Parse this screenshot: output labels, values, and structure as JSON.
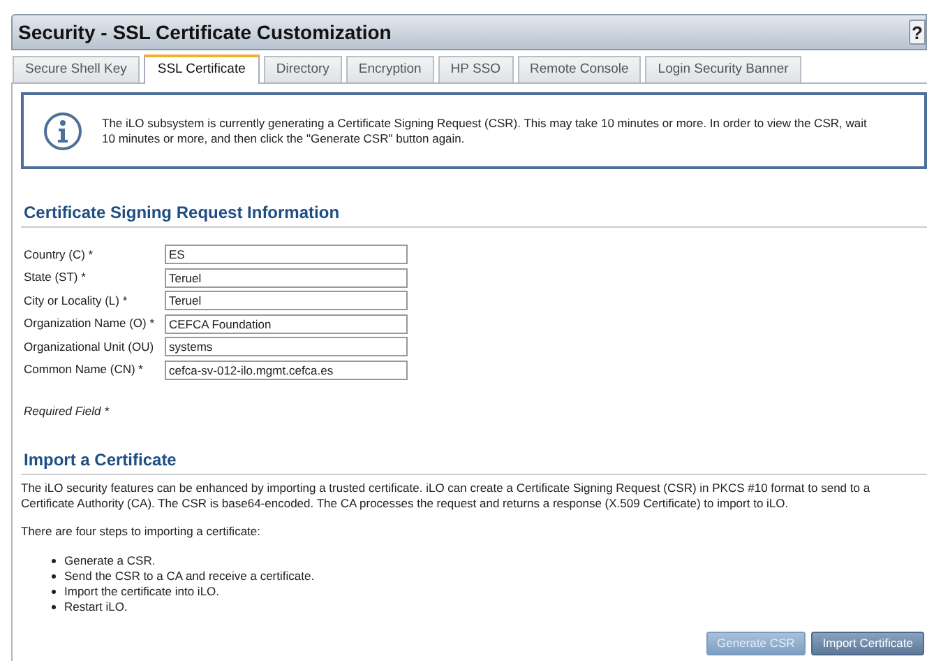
{
  "window": {
    "title": "Security - SSL Certificate Customization",
    "help": "?"
  },
  "tabs": [
    {
      "label": "Secure Shell Key",
      "selected": false
    },
    {
      "label": "SSL Certificate",
      "selected": true
    },
    {
      "label": "Directory",
      "selected": false
    },
    {
      "label": "Encryption",
      "selected": false
    },
    {
      "label": "HP SSO",
      "selected": false
    },
    {
      "label": "Remote Console",
      "selected": false
    },
    {
      "label": "Login Security Banner",
      "selected": false
    }
  ],
  "notice": "The iLO subsystem is currently generating a Certificate Signing Request (CSR). This may take 10 minutes or more. In order to view the CSR, wait 10 minutes or more, and then click the \"Generate CSR\" button again.",
  "csr_section": {
    "heading": "Certificate Signing Request Information",
    "fields": [
      {
        "label": "Country (C) *",
        "value": "ES"
      },
      {
        "label": "State (ST) *",
        "value": "Teruel"
      },
      {
        "label": "City or Locality (L) *",
        "value": "Teruel"
      },
      {
        "label": "Organization Name (O) *",
        "value": "CEFCA Foundation"
      },
      {
        "label": "Organizational Unit (OU)",
        "value": "systems"
      },
      {
        "label": "Common Name (CN) *",
        "value": "cefca-sv-012-ilo.mgmt.cefca.es"
      }
    ],
    "required_note": "Required Field *"
  },
  "import_section": {
    "heading": "Import a Certificate",
    "description": "The iLO security features can be enhanced by importing a trusted certificate. iLO can create a Certificate Signing Request (CSR) in PKCS #10 format to send to a Certificate Authority (CA). The CSR is base64-encoded. The CA processes the request and returns a response (X.509 Certificate) to import to iLO.",
    "steps_intro": "There are four steps to importing a certificate:",
    "steps": [
      "Generate a CSR.",
      "Send the CSR to a CA and receive a certificate.",
      "Import the certificate into iLO.",
      "Restart iLO."
    ]
  },
  "buttons": [
    {
      "label": "Generate CSR",
      "disabled": true
    },
    {
      "label": "Import Certificate",
      "disabled": false
    }
  ]
}
